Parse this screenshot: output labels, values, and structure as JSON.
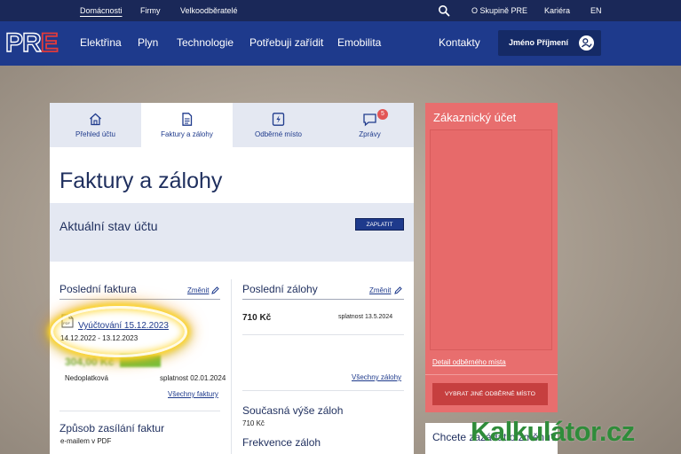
{
  "topbar": {
    "items": [
      "Domácnosti",
      "Firmy",
      "Velkoodběratelé"
    ],
    "right_items": [
      "O Skupině PRE",
      "Kariéra",
      "EN"
    ]
  },
  "mainnav": {
    "logo": "PRE",
    "links": [
      "Elektřina",
      "Plyn",
      "Technologie",
      "Potřebuji zařídit",
      "Emobilita"
    ],
    "contacts": "Kontakty",
    "user_name": "Jméno Příjmení"
  },
  "tabs": [
    {
      "label": "Přehled účtu",
      "icon": "home-icon"
    },
    {
      "label": "Faktury a zálohy",
      "icon": "document-icon"
    },
    {
      "label": "Odběrné místo",
      "icon": "lightning-icon"
    },
    {
      "label": "Zprávy",
      "icon": "message-icon",
      "badge": "5"
    }
  ],
  "page": {
    "title": "Faktury a zálohy",
    "account_state": "Aktuální stav účtu",
    "pay_button": "ZAPLATIT"
  },
  "last_invoice": {
    "title": "Poslední faktura",
    "change": "Změnit",
    "invoice_link": "Vyúčtování 15.12.2023",
    "period": "14.12.2022 - 13.12.2023",
    "amount": "304,00 Kč",
    "status": "Nedoplatková",
    "due": "splatnost 02.01.2024",
    "all_link": "Všechny faktury"
  },
  "sending": {
    "title": "Způsob zasílání faktur",
    "value": "e-mailem v PDF"
  },
  "last_advances": {
    "title": "Poslední zálohy",
    "change": "Změnit",
    "amount": "710 Kč",
    "due": "splatnost 13.5.2024",
    "all_link": "Všechny zálohy",
    "current_title": "Současná výše záloh",
    "current_value": "710 Kč",
    "frequency_title": "Frekvence záloh"
  },
  "customer_account": {
    "title": "Zákaznický účet",
    "detail_link": "Detail odběrného místa",
    "select_button": "VYBRAT JINÉ ODBĚRNÉ MÍSTO"
  },
  "question_card": {
    "text": "Chcete zažádat o změnu?"
  },
  "watermark": "Kalkulátor.cz",
  "colors": {
    "navy": "#1a2858",
    "nav_blue": "#1e3a8c",
    "red_panel": "#e86e6e",
    "red_button": "#c63f3f",
    "green": "#6ec33f",
    "logo_red": "#e23b3b"
  }
}
